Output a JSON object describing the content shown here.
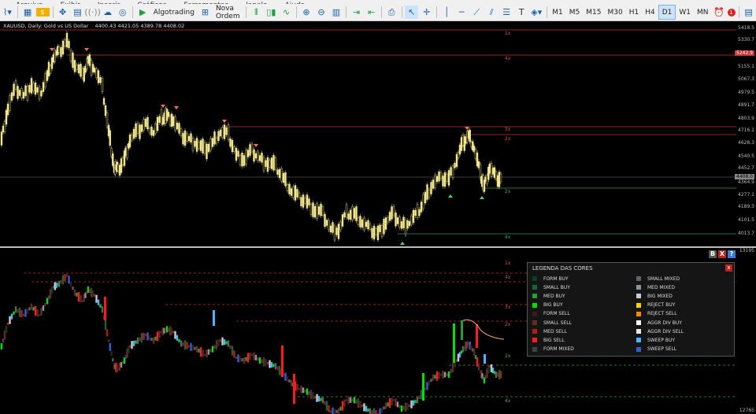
{
  "menu": [
    "Arquivo",
    "Exibir",
    "Inserir",
    "Gráficos",
    "Ferramentas",
    "Janela",
    "Ajuda"
  ],
  "toolbar": {
    "algotrading": "Algotrading",
    "new_order": "Nova Ordem",
    "timeframes": [
      "M1",
      "M5",
      "M15",
      "M30",
      "H1",
      "H4",
      "D1",
      "W1",
      "MN"
    ],
    "active_timeframe": "D1",
    "notification_count": "1"
  },
  "chart": {
    "symbol_info": "XAUUSD, Daily: Gold vs US Dollar",
    "ohlc": "4400.43 4421.05 4389.78 4408.02",
    "price_labels": [
      "5418.5",
      "5330.7",
      "5242.9",
      "5155.1",
      "5067.3",
      "4979.5",
      "4891.7",
      "4803.9",
      "4716.1",
      "4628.3",
      "4540.5",
      "4452.7",
      "4408.0",
      "4364.9",
      "4277.1",
      "4189.3",
      "4101.5",
      "4013.7"
    ],
    "highlight_price": "5242.9",
    "current_price": "4408.0",
    "level_tags": [
      "1x",
      "4x",
      "3x",
      "2x",
      "2x",
      "4x"
    ],
    "indicator_labels": [
      "13195",
      "12765"
    ],
    "indicator_tags": [
      "1x",
      "4x",
      "3x",
      "2x",
      "2x",
      "4x"
    ]
  },
  "panel_buttons": [
    "B",
    "X",
    "?"
  ],
  "legend": {
    "title": "LEGENDA DAS CORES",
    "close": "x",
    "left": [
      {
        "label": "FORM BUY",
        "color": "#0f3d22"
      },
      {
        "label": "SMALL BUY",
        "color": "#17633a"
      },
      {
        "label": "MED BUY",
        "color": "#1f9d3f"
      },
      {
        "label": "BIG BUY",
        "color": "#00e000"
      },
      {
        "label": "FORM SELL",
        "color": "#3d1a1a"
      },
      {
        "label": "SMALL SELL",
        "color": "#6b2626"
      },
      {
        "label": "MED SELL",
        "color": "#b01c1c"
      },
      {
        "label": "BIG SELL",
        "color": "#ff1a1a"
      },
      {
        "label": "FORM MIXED",
        "color": "#3c4248"
      }
    ],
    "right": [
      {
        "label": "SMALL MIXED",
        "color": "#5a626a"
      },
      {
        "label": "MED MIXED",
        "color": "#8c9399"
      },
      {
        "label": "BIG MIXED",
        "color": "#c6ccd1"
      },
      {
        "label": "REJECT BUY",
        "color": "#ffd000"
      },
      {
        "label": "REJECT SELL",
        "color": "#ff8a00"
      },
      {
        "label": "AGGR DIV BUY",
        "color": "#ffffff"
      },
      {
        "label": "AGGR DIV SELL",
        "color": "#e8e8e8"
      },
      {
        "label": "SWEEP BUY",
        "color": "#4fb3ff"
      },
      {
        "label": "SWEEP SELL",
        "color": "#2f5fd0"
      }
    ]
  }
}
